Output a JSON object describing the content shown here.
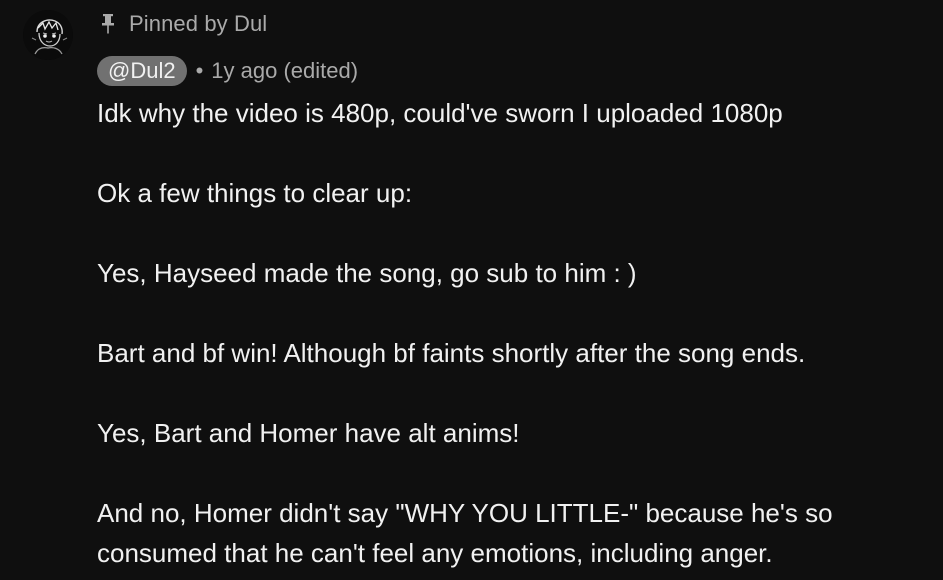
{
  "comment": {
    "pinned_label": "Pinned by Dul",
    "author": "@Dul2",
    "separator": "•",
    "timestamp": "1y ago (edited)",
    "lines": [
      "Idk why the video is 480p, could've sworn I uploaded 1080p",
      "",
      "Ok a few things to clear up:",
      "",
      "Yes, Hayseed made the song, go sub to him : )",
      "",
      "Bart and bf win! Although bf faints shortly after the song ends.",
      "",
      "Yes, Bart and Homer have alt anims!",
      "",
      "And no, Homer didn't say \"WHY YOU LITTLE-\" because he's so",
      "consumed that he can't feel any emotions, including anger."
    ]
  },
  "icons": {
    "avatar": "sketched-character-avatar",
    "pin": "pin-icon"
  },
  "colors": {
    "background": "#0f0f0f",
    "text_primary": "#f1f1f1",
    "text_secondary": "#aaaaaa",
    "author_chip": "#717171"
  }
}
